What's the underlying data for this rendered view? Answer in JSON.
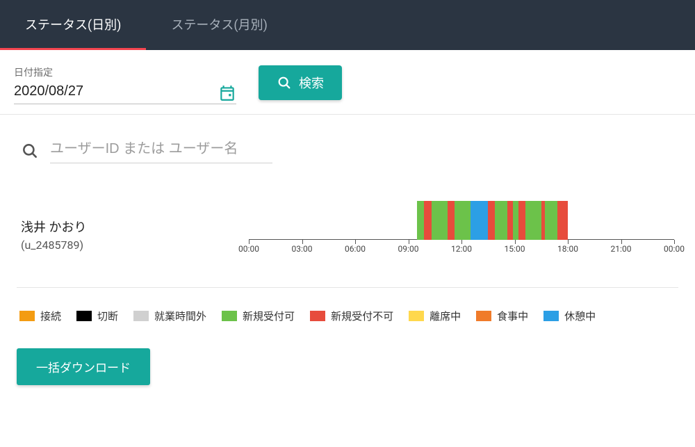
{
  "tabs": {
    "daily": "ステータス(日別)",
    "monthly": "ステータス(月別)"
  },
  "filters": {
    "date_label": "日付指定",
    "date_value": "2020/08/27",
    "search_label": "検索"
  },
  "user_search": {
    "placeholder": "ユーザーID または ユーザー名"
  },
  "user": {
    "name": "浅井 かおり",
    "id": "(u_2485789)"
  },
  "download_label": "一括ダウンロード",
  "legend": [
    {
      "label": "接続",
      "color": "#f39c12"
    },
    {
      "label": "切断",
      "color": "#000000"
    },
    {
      "label": "就業時間外",
      "color": "#d0d0d0"
    },
    {
      "label": "新規受付可",
      "color": "#6cc24a"
    },
    {
      "label": "新規受付不可",
      "color": "#e74c3c"
    },
    {
      "label": "離席中",
      "color": "#ffd84d"
    },
    {
      "label": "食事中",
      "color": "#f07b2a"
    },
    {
      "label": "休憩中",
      "color": "#2c9fe5"
    }
  ],
  "chart_data": {
    "type": "bar",
    "title": "",
    "xlabel": "",
    "ylabel": "",
    "x_ticks": [
      "00:00",
      "03:00",
      "06:00",
      "09:00",
      "12:00",
      "15:00",
      "18:00",
      "21:00",
      "00:00"
    ],
    "x_range_hours": [
      0,
      24
    ],
    "series_key": "status",
    "series": [
      {
        "status": "新規受付可",
        "color": "#6cc24a",
        "start_h": 9.5,
        "end_h": 9.9
      },
      {
        "status": "新規受付不可",
        "color": "#e74c3c",
        "start_h": 9.9,
        "end_h": 10.3
      },
      {
        "status": "新規受付可",
        "color": "#6cc24a",
        "start_h": 10.3,
        "end_h": 11.2
      },
      {
        "status": "新規受付不可",
        "color": "#e74c3c",
        "start_h": 11.2,
        "end_h": 11.6
      },
      {
        "status": "新規受付可",
        "color": "#6cc24a",
        "start_h": 11.6,
        "end_h": 12.5
      },
      {
        "status": "休憩中",
        "color": "#2c9fe5",
        "start_h": 12.5,
        "end_h": 13.5
      },
      {
        "status": "新規受付不可",
        "color": "#e74c3c",
        "start_h": 13.5,
        "end_h": 13.9
      },
      {
        "status": "新規受付可",
        "color": "#6cc24a",
        "start_h": 13.9,
        "end_h": 14.6
      },
      {
        "status": "新規受付不可",
        "color": "#e74c3c",
        "start_h": 14.6,
        "end_h": 14.9
      },
      {
        "status": "新規受付可",
        "color": "#6cc24a",
        "start_h": 14.9,
        "end_h": 15.2
      },
      {
        "status": "新規受付不可",
        "color": "#e74c3c",
        "start_h": 15.2,
        "end_h": 15.6
      },
      {
        "status": "新規受付可",
        "color": "#6cc24a",
        "start_h": 15.6,
        "end_h": 16.5
      },
      {
        "status": "新規受付不可",
        "color": "#e74c3c",
        "start_h": 16.5,
        "end_h": 16.7
      },
      {
        "status": "新規受付可",
        "color": "#6cc24a",
        "start_h": 16.7,
        "end_h": 17.4
      },
      {
        "status": "新規受付不可",
        "color": "#e74c3c",
        "start_h": 17.4,
        "end_h": 18.0
      }
    ]
  }
}
